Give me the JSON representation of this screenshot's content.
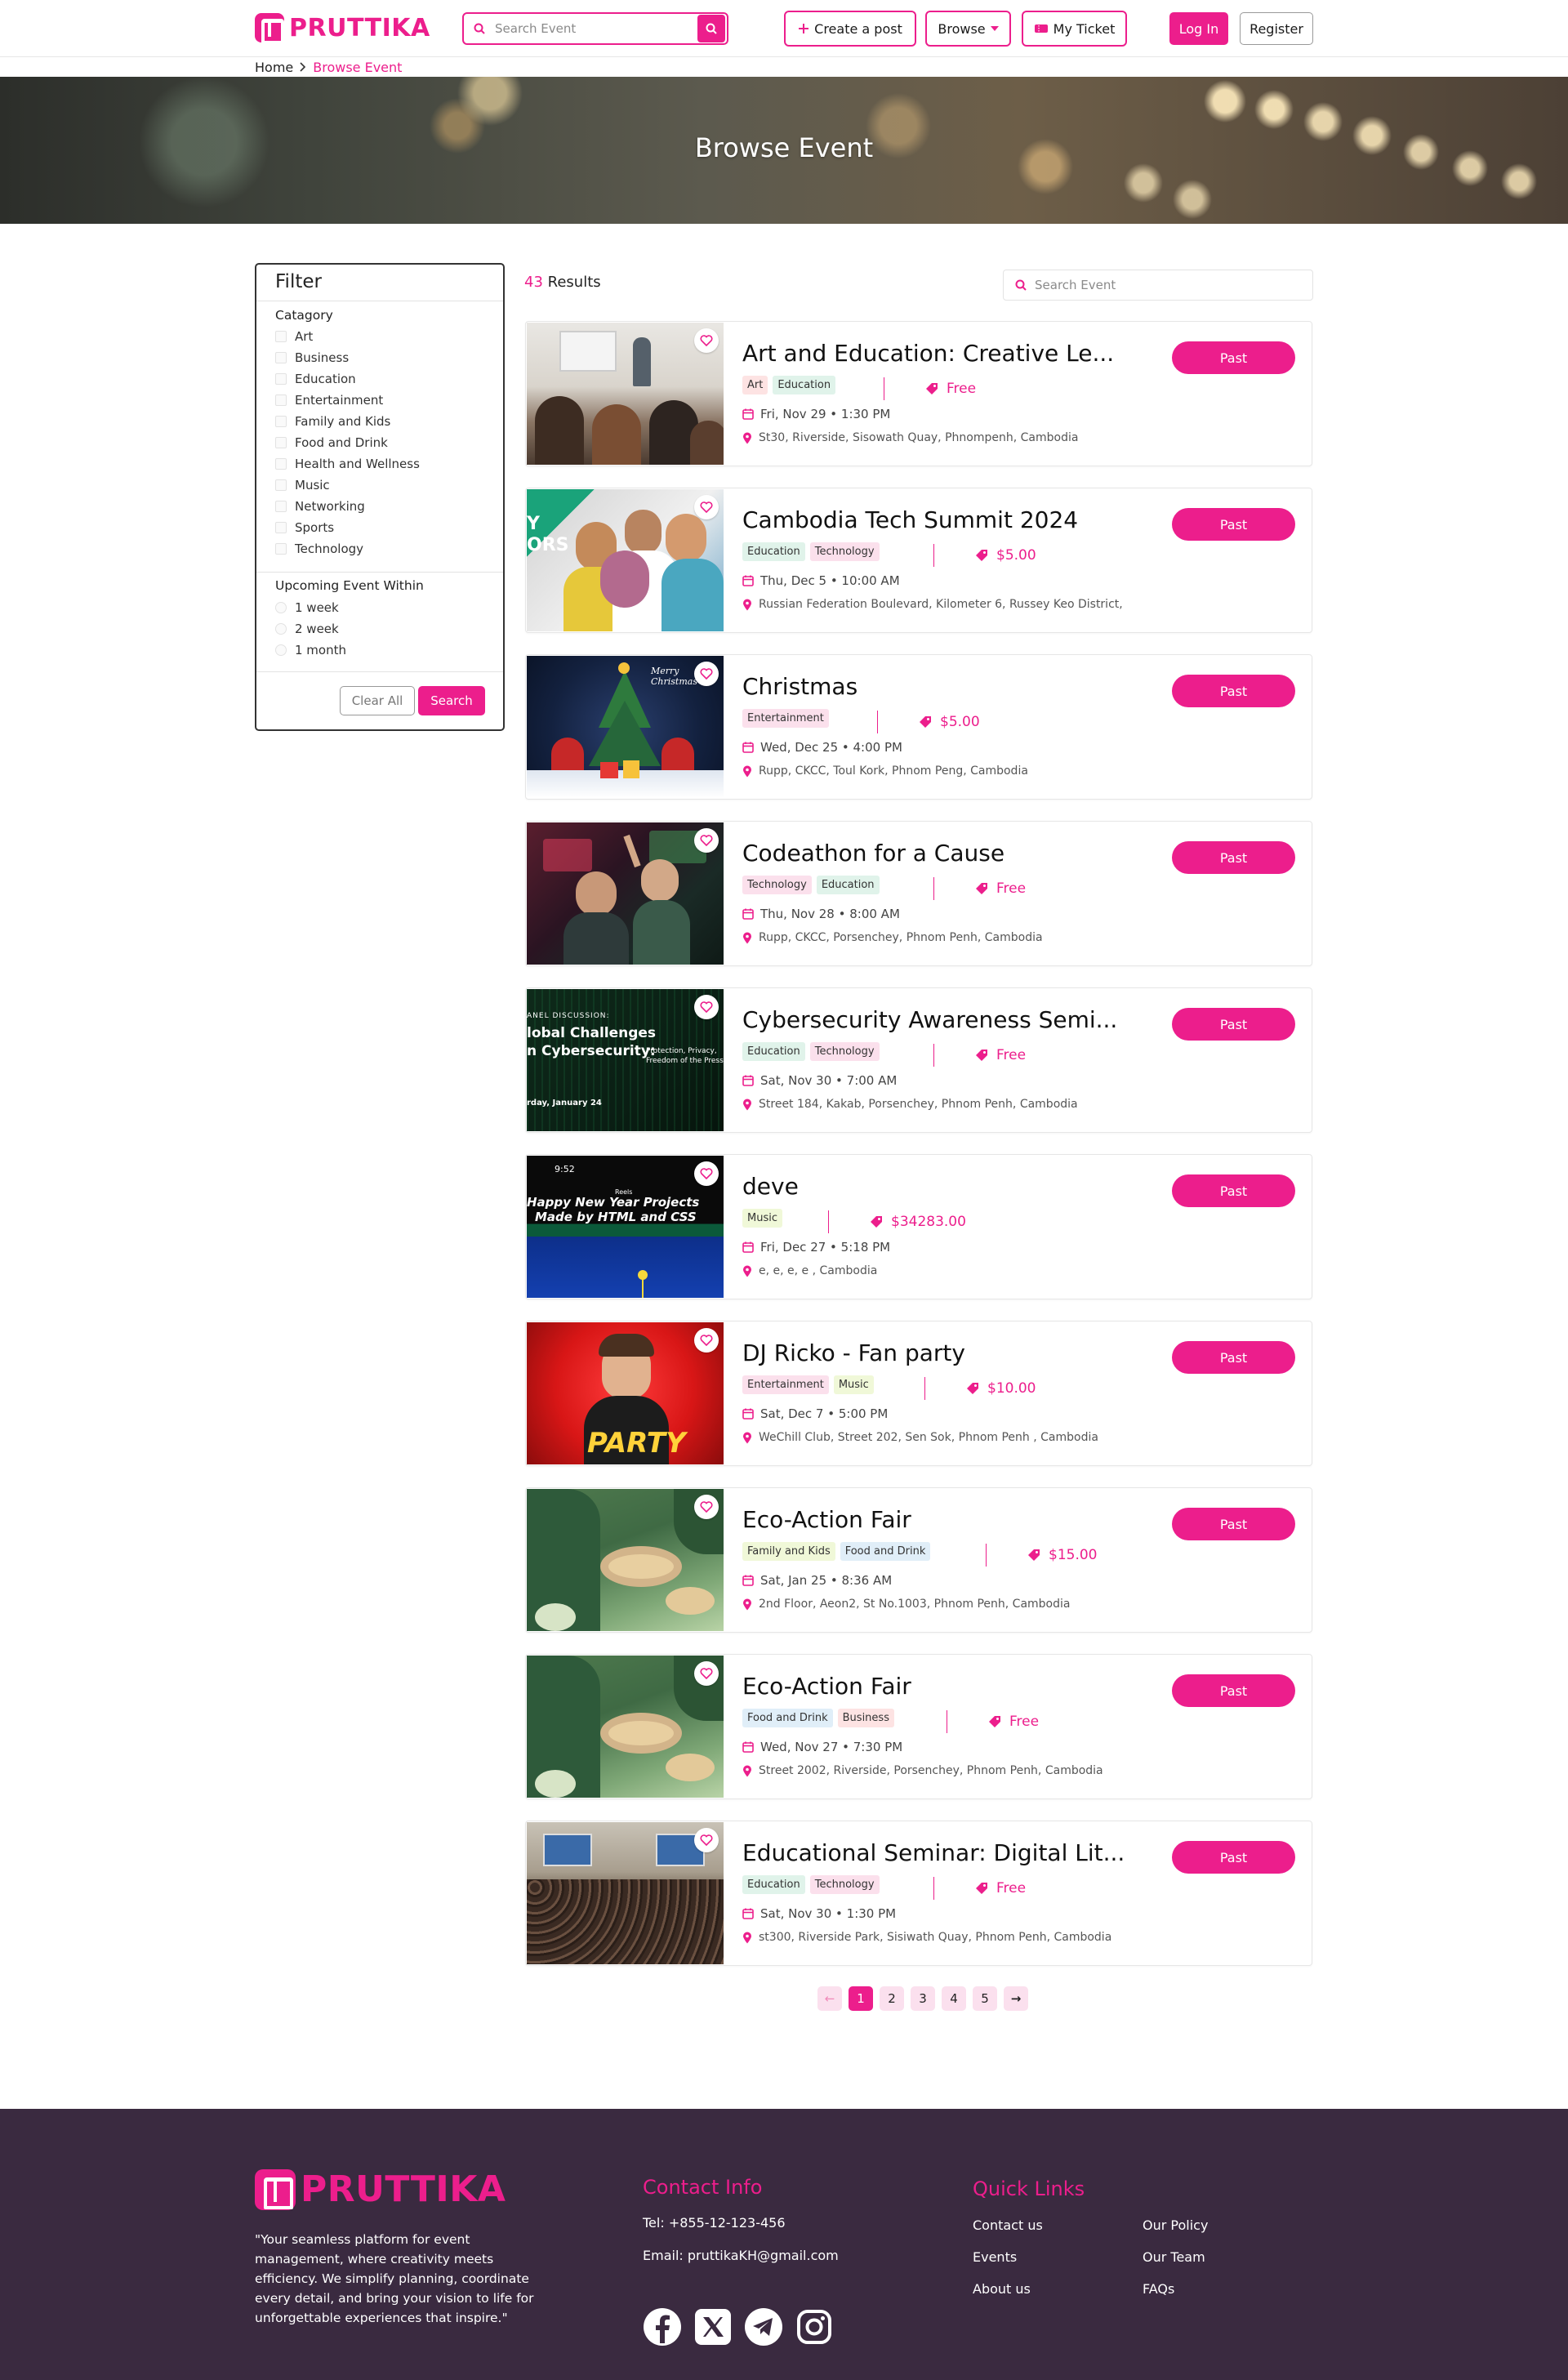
{
  "header": {
    "brand": "PRUTTIKA",
    "search_placeholder": "Search Event",
    "create_label": "Create a post",
    "browse_label": "Browse",
    "ticket_label": "My Ticket",
    "login_label": "Log In",
    "register_label": "Register"
  },
  "breadcrumb": {
    "home": "Home",
    "current": "Browse Event"
  },
  "hero": {
    "title": "Browse Event"
  },
  "filter": {
    "title": "Filter",
    "category_title": "Catagory",
    "categories": [
      "Art",
      "Business",
      "Education",
      "Entertainment",
      "Family and Kids",
      "Food and Drink",
      "Health and Wellness",
      "Music",
      "Networking",
      "Sports",
      "Technology"
    ],
    "upcoming_title": "Upcoming Event Within",
    "upcoming": [
      "1 week",
      "2 week",
      "1 month"
    ],
    "clear_label": "Clear All",
    "search_label": "Search"
  },
  "results": {
    "count": "43",
    "label": "Results",
    "search_placeholder": "Search Event"
  },
  "events": [
    {
      "title": "Art and Education: Creative Le...",
      "tags": [
        "Art",
        "Education"
      ],
      "price": "Free",
      "date": "Fri, Nov 29 • 1:30 PM",
      "location": "St30, Riverside, Sisowath Quay, Phnompenh, Cambodia",
      "status": "Past"
    },
    {
      "title": "Cambodia Tech Summit 2024",
      "tags": [
        "Education",
        "Technology"
      ],
      "price": "$5.00",
      "date": "Thu, Dec 5 • 10:00 AM",
      "location": "Russian Federation Boulevard, Kilometer 6, Russey Keo District,",
      "status": "Past"
    },
    {
      "title": "Christmas",
      "tags": [
        "Entertainment"
      ],
      "price": "$5.00",
      "date": "Wed, Dec 25 • 4:00 PM",
      "location": "Rupp, CKCC, Toul Kork, Phnom Peng, Cambodia",
      "status": "Past"
    },
    {
      "title": "Codeathon for a Cause",
      "tags": [
        "Technology",
        "Education"
      ],
      "price": "Free",
      "date": "Thu, Nov 28 • 8:00 AM",
      "location": "Rupp, CKCC, Porsenchey, Phnom Penh, Cambodia",
      "status": "Past"
    },
    {
      "title": "Cybersecurity Awareness Semi...",
      "tags": [
        "Education",
        "Technology"
      ],
      "price": "Free",
      "date": "Sat, Nov 30 • 7:00 AM",
      "location": "Street 184, Kakab, Porsenchey, Phnom Penh, Cambodia",
      "status": "Past"
    },
    {
      "title": "deve",
      "tags": [
        "Music"
      ],
      "price": "$34283.00",
      "date": "Fri, Dec 27 • 5:18 PM",
      "location": "e, e, e, e , Cambodia",
      "status": "Past"
    },
    {
      "title": "DJ Ricko - Fan party",
      "tags": [
        "Entertainment",
        "Music"
      ],
      "price": "$10.00",
      "date": "Sat, Dec 7 • 5:00 PM",
      "location": "WeChill Club, Street 202, Sen Sok, Phnom Penh , Cambodia",
      "status": "Past"
    },
    {
      "title": "Eco-Action Fair",
      "tags": [
        "Family and Kids",
        "Food and Drink"
      ],
      "price": "$15.00",
      "date": "Sat, Jan 25 • 8:36 AM",
      "location": "2nd Floor, Aeon2, St No.1003, Phnom Penh, Cambodia",
      "status": "Past"
    },
    {
      "title": "Eco-Action Fair",
      "tags": [
        "Food and Drink",
        "Business"
      ],
      "price": "Free",
      "date": "Wed, Nov 27 • 7:30 PM",
      "location": "Street 2002, Riverside, Porsenchey, Phnom Penh, Cambodia",
      "status": "Past"
    },
    {
      "title": "Educational Seminar: Digital Lit...",
      "tags": [
        "Education",
        "Technology"
      ],
      "price": "Free",
      "date": "Sat, Nov 30 • 1:30 PM",
      "location": "st300, Riverside Park, Sisiwath Quay, Phnom Penh, Cambodia",
      "status": "Past"
    }
  ],
  "thumb_text": {
    "christmas": "Merry Christmas",
    "cyber_top": "ANEL DISCUSSION:",
    "cyber_main1": "lobal Challenges",
    "cyber_main2": "n Cybersecurity:",
    "cyber_side": "Protection, Privacy, Freedom of the Press",
    "cyber_date": "rday, January 24",
    "deve_time": "9:52",
    "deve_small": "Reels",
    "deve_line1": "Happy New Year Projects",
    "deve_line2": "Made by HTML and CSS",
    "dj_word": "PARTY",
    "tech_side1": "Y",
    "tech_side2": "ORS"
  },
  "pagination": {
    "prev": "←",
    "pages": [
      "1",
      "2",
      "3",
      "4",
      "5"
    ],
    "next": "→"
  },
  "footer": {
    "brand": "PRUTTIKA",
    "description": "\"Your seamless platform for event management, where creativity meets efficiency. We simplify planning, coordinate every detail, and bring your vision to life for unforgettable experiences that inspire.\"",
    "contact_title": "Contact Info",
    "tel": "Tel: +855-12-123-456",
    "email": "Email: pruttikaKH@gmail.com",
    "quick_title": "Quick Links",
    "links_col1": [
      "Contact us",
      "Events",
      "About us"
    ],
    "links_col2": [
      "Our Policy",
      "Our Team",
      "FAQs"
    ]
  },
  "colors": {
    "accent": "#ec1e8c",
    "footer_bg": "#3a2a40"
  }
}
